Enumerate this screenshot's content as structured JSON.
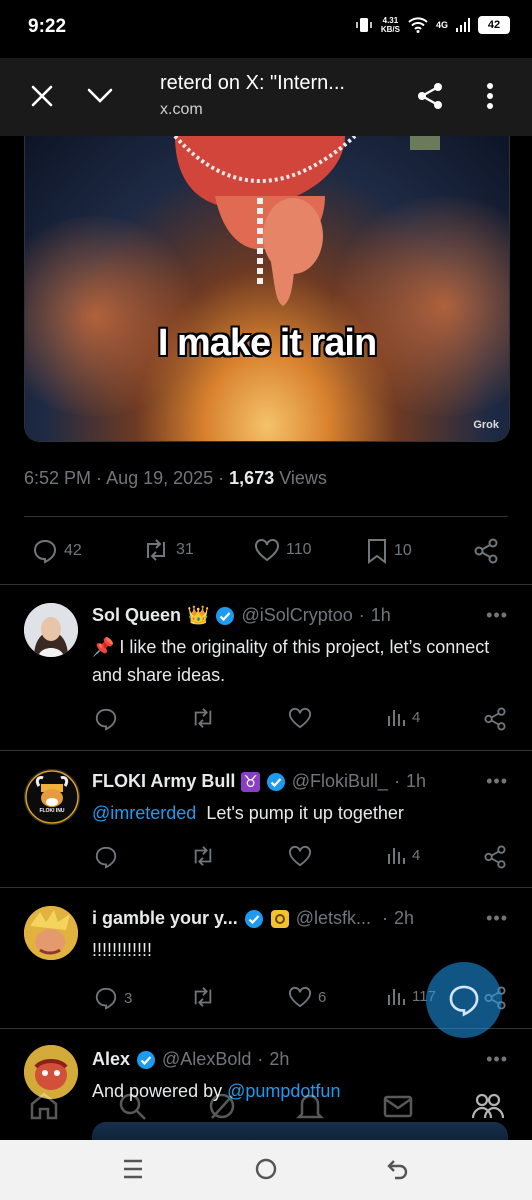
{
  "status_bar": {
    "time": "9:22",
    "net_speed_value": "4.31",
    "net_speed_unit": "KB/S",
    "network": "4G",
    "battery": "42"
  },
  "browser": {
    "title": "reterd on X: \"Intern...",
    "url": "x.com"
  },
  "media": {
    "caption": "I make it rain",
    "watermark": "Grok"
  },
  "tweet": {
    "time": "6:52 PM",
    "date": "Aug 19, 2025",
    "views": "1,673",
    "views_label": "Views",
    "replies": "42",
    "reposts": "31",
    "likes": "110",
    "bookmarks": "10"
  },
  "replies": [
    {
      "name": "Sol Queen",
      "emoji": "👑",
      "handle": "@iSolCryptoo",
      "time": "1h",
      "text": "📌 I like the originality of this project, let’s connect and share ideas.",
      "views": "4"
    },
    {
      "name": "FLOKI Army Bull",
      "emoji": "♉",
      "handle": "@FlokiBull_",
      "time": "1h",
      "mention": "@imreterded",
      "text": "Let's pump it up together",
      "views": "4",
      "avatar_text": "FLOKI INU"
    },
    {
      "name": "i gamble your y...",
      "handle": "@letsfk...",
      "time": "2h",
      "text": "!!!!!!!!!!!!",
      "replies": "3",
      "likes": "6",
      "views": "117"
    },
    {
      "name": "Alex",
      "handle": "@AlexBold",
      "time": "2h",
      "text_prefix": "And powered by",
      "mention": "@pumpdotfun"
    }
  ],
  "more_glyph": "•••",
  "colors": {
    "accent": "#1d9bf0",
    "muted": "#71767b",
    "background": "#000000"
  },
  "icons": [
    "close-icon",
    "chevron-down-icon",
    "share-icon",
    "more-vert-icon",
    "reply-icon",
    "repost-icon",
    "like-icon",
    "bookmark-icon",
    "views-icon",
    "home-icon",
    "search-icon",
    "grok-icon",
    "notifications-icon",
    "messages-icon",
    "communities-icon"
  ]
}
